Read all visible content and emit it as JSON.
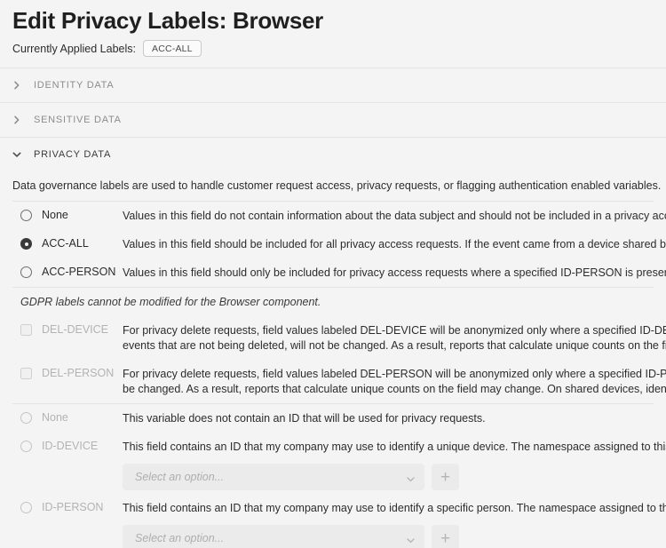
{
  "header": {
    "title": "Edit Privacy Labels: Browser",
    "applied_labels_label": "Currently Applied Labels:",
    "applied_labels": [
      "ACC-ALL"
    ]
  },
  "accordion": [
    {
      "id": "identity-data",
      "title": "IDENTITY DATA",
      "expanded": false,
      "chevron": "chevron-right-icon"
    },
    {
      "id": "sensitive-data",
      "title": "SENSITIVE DATA",
      "expanded": false,
      "chevron": "chevron-right-icon"
    },
    {
      "id": "privacy-data",
      "title": "PRIVACY DATA",
      "expanded": true,
      "chevron": "chevron-down-icon"
    }
  ],
  "privacy_data": {
    "description": "Data governance labels are used to handle customer request access, privacy requests, or flagging authentication enabled variables.",
    "access_options": [
      {
        "label": "None",
        "selected": false,
        "disabled": false,
        "desc": "Values in this field do not contain information about the data subject and should not be included in a privacy acce"
      },
      {
        "label": "ACC-ALL",
        "selected": true,
        "disabled": false,
        "desc": "Values in this field should be included for all privacy access requests. If the event came from a device shared by m"
      },
      {
        "label": "ACC-PERSON",
        "selected": false,
        "disabled": false,
        "desc": "Values in this field should only be included for privacy access requests where a specified ID-PERSON is present in"
      }
    ],
    "gdpr_note": "GDPR labels cannot be modified for the Browser component.",
    "delete_options": [
      {
        "label": "DEL-DEVICE",
        "checked": false,
        "disabled": true,
        "desc_line1": "For privacy delete requests, field values labeled DEL-DEVICE will be anonymized only where a specified ID-DEVIC",
        "desc_line2": "events that are not being deleted, will not be changed. As a result, reports that calculate unique counts on the fiel"
      },
      {
        "label": "DEL-PERSON",
        "checked": false,
        "disabled": true,
        "desc_line1": "For privacy delete requests, field values labeled DEL-PERSON will be anonymized only where a specified ID-PERS",
        "desc_line2": "be changed. As a result, reports that calculate unique counts on the field may change. On shared devices, identifie"
      }
    ],
    "id_options": [
      {
        "label": "None",
        "selected": false,
        "disabled": true,
        "desc": "This variable does not contain an ID that will be used for privacy requests.",
        "has_select": false
      },
      {
        "label": "ID-DEVICE",
        "selected": false,
        "disabled": true,
        "desc": "This field contains an ID that my company may use to identify a unique device. The namespace assigned to this ID",
        "has_select": true,
        "select_placeholder": "Select an option...",
        "select_value": "",
        "add_button_label": "+"
      },
      {
        "label": "ID-PERSON",
        "selected": false,
        "disabled": true,
        "desc": "This field contains an ID that my company may use to identify a specific person. The namespace assigned to this I",
        "has_select": true,
        "select_placeholder": "Select an option...",
        "select_value": "",
        "add_button_label": "+"
      }
    ]
  },
  "icons": {
    "chevron_right": "chevron-right-icon",
    "chevron_down": "chevron-down-icon",
    "select_chevron": "chevron-down-icon",
    "plus": "plus-icon"
  },
  "colors": {
    "background": "#f4f4f4",
    "divider": "#e3e3e3",
    "text": "#2c2c2c",
    "muted_text": "#b3b3b3",
    "control_bg": "#ebebeb"
  }
}
